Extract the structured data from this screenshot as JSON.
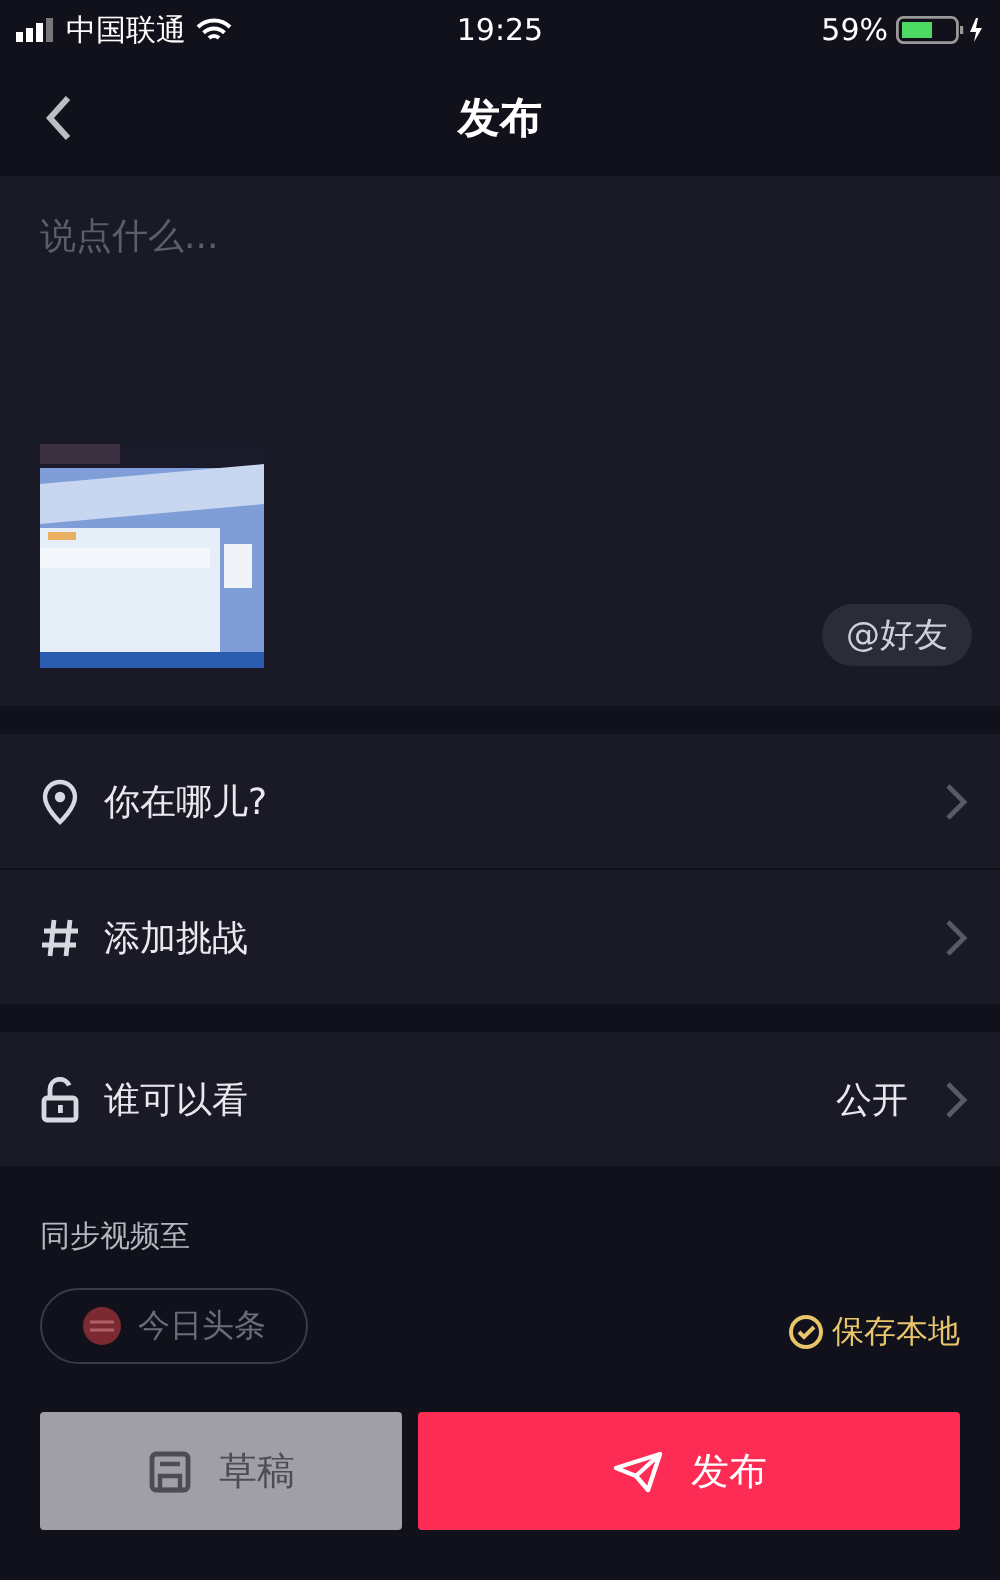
{
  "status_bar": {
    "carrier": "中国联通",
    "time": "19:25",
    "battery": "59%"
  },
  "header": {
    "title": "发布"
  },
  "compose": {
    "placeholder": "说点什么...",
    "mention": "@好友"
  },
  "options": [
    {
      "kind": "location",
      "label": "你在哪儿?"
    },
    {
      "kind": "hashtag",
      "label": "添加挑战"
    }
  ],
  "privacy": {
    "label": "谁可以看",
    "value": "公开"
  },
  "sync": {
    "label": "同步视频至",
    "targets": [
      {
        "label": "今日头条",
        "selected": false
      }
    ],
    "save_local": {
      "label": "保存本地",
      "checked": true
    }
  },
  "buttons": [
    {
      "kind": "draft",
      "label": "草稿"
    },
    {
      "kind": "publish",
      "label": "发布"
    }
  ]
}
